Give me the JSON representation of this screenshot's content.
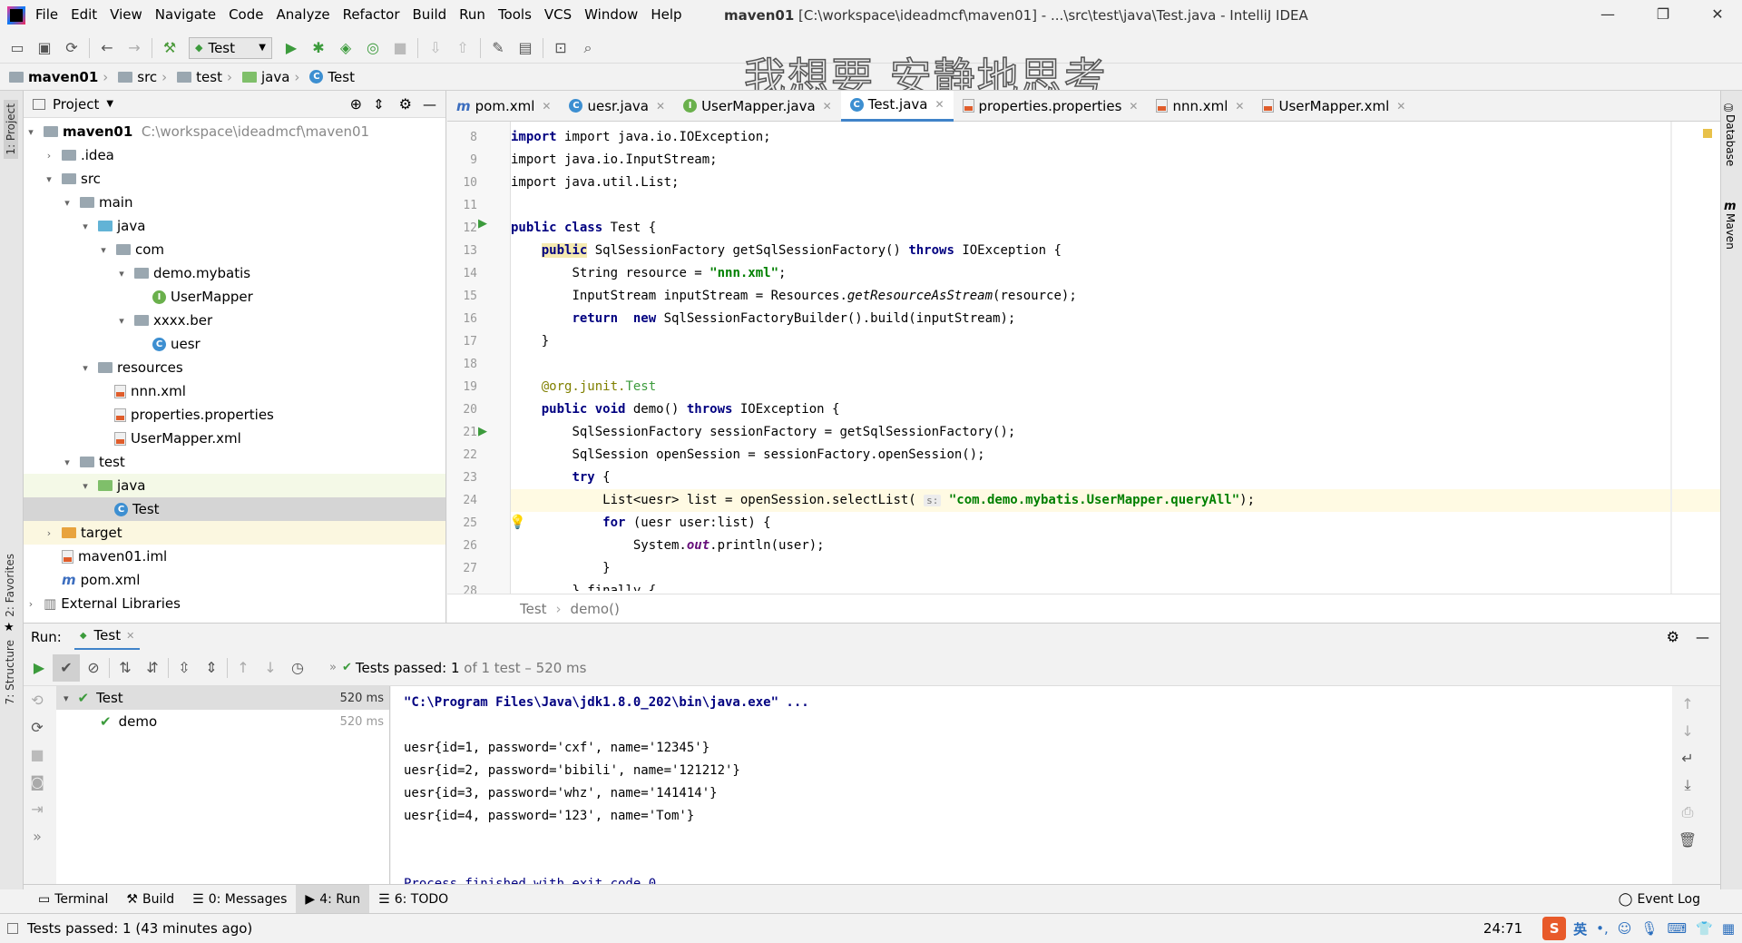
{
  "window": {
    "menu": [
      "File",
      "Edit",
      "View",
      "Navigate",
      "Code",
      "Analyze",
      "Refactor",
      "Build",
      "Run",
      "Tools",
      "VCS",
      "Window",
      "Help"
    ],
    "title_project": "maven01",
    "title_rest": "[C:\\workspace\\ideadmcf\\maven01] - ...\\src\\test\\java\\Test.java - IntelliJ IDEA"
  },
  "toolbar": {
    "run_config": "Test"
  },
  "overlay_text": "我想要 安静地思考",
  "breadcrumbs": [
    "maven01",
    "src",
    "test",
    "java",
    "Test"
  ],
  "left_strip": {
    "project": "1: Project",
    "favorites": "2: Favorites",
    "structure": "7: Structure"
  },
  "right_strip": {
    "database": "Database",
    "maven": "Maven"
  },
  "project_panel": {
    "title": "Project",
    "tree": [
      {
        "label": "maven01",
        "extra": "C:\\workspace\\ideadmcf\\maven01"
      },
      {
        "label": ".idea"
      },
      {
        "label": "src"
      },
      {
        "label": "main"
      },
      {
        "label": "java"
      },
      {
        "label": "com"
      },
      {
        "label": "demo.mybatis"
      },
      {
        "label": "UserMapper"
      },
      {
        "label": "xxxx.ber"
      },
      {
        "label": "uesr"
      },
      {
        "label": "resources"
      },
      {
        "label": "nnn.xml"
      },
      {
        "label": "properties.properties"
      },
      {
        "label": "UserMapper.xml"
      },
      {
        "label": "test"
      },
      {
        "label": "java"
      },
      {
        "label": "Test"
      },
      {
        "label": "target"
      },
      {
        "label": "maven01.iml"
      },
      {
        "label": "pom.xml"
      },
      {
        "label": "External Libraries"
      }
    ]
  },
  "editor_tabs": [
    "pom.xml",
    "uesr.java",
    "UserMapper.java",
    "Test.java",
    "properties.properties",
    "nnn.xml",
    "UserMapper.xml"
  ],
  "line_numbers": [
    "8",
    "9",
    "10",
    "11",
    "12",
    "13",
    "14",
    "15",
    "16",
    "17",
    "18",
    "19",
    "20",
    "21",
    "22",
    "23",
    "24",
    "25",
    "26",
    "27",
    "28"
  ],
  "code": {
    "l8": "import java.io.IOException;",
    "l9": "import java.io.InputStream;",
    "l10": "import java.util.List;",
    "l12_kw": "public class",
    "l12_rest": " Test {",
    "l13_a": "public",
    "l13_b": " SqlSessionFactory getSqlSessionFactory() ",
    "l13_c": "throws",
    "l13_d": " IOException {",
    "l14_a": "String resource = ",
    "l14_b": "\"nnn.xml\"",
    "l14_c": ";",
    "l15_a": "InputStream inputStream = Resources.",
    "l15_b": "getResourceAsStream",
    "l15_c": "(resource);",
    "l16_a": "return  new",
    "l16_b": " SqlSessionFactoryBuilder().build(inputStream);",
    "l17": "}",
    "l19_a": "@org.junit.",
    "l19_b": "Test",
    "l20_a": "public void",
    "l20_b": " demo() ",
    "l20_c": "throws",
    "l20_d": " IOException {",
    "l21": "SqlSessionFactory sessionFactory = getSqlSessionFactory();",
    "l22": "SqlSession openSession = sessionFactory.openSession();",
    "l23_a": "try",
    "l23_b": " {",
    "l24_a": "List<uesr> list = openSession.selectList( ",
    "l24_hint": "s:",
    "l24_b": " \"com.demo.mybatis.UserMapper.queryAll\"",
    "l24_c": ");",
    "l25_a": "for",
    "l25_b": " (uesr user:list) {",
    "l26_a": "System.",
    "l26_b": "out",
    "l26_c": ".println(user);",
    "l27": "}",
    "l28": "} finally {"
  },
  "editor_breadcrumb": [
    "Test",
    "demo()"
  ],
  "run_panel": {
    "label": "Run:",
    "tab": "Test",
    "status_prefix": "Tests passed:",
    "status_count": "1",
    "status_rest": "of 1 test – 520 ms",
    "tests": [
      {
        "name": "Test",
        "time": "520 ms"
      },
      {
        "name": "demo",
        "time": "520 ms"
      }
    ],
    "console": [
      "\"C:\\Program Files\\Java\\jdk1.8.0_202\\bin\\java.exe\" ...",
      "",
      "uesr{id=1, password='cxf', name='12345'}",
      "uesr{id=2, password='bibili', name='121212'}",
      "uesr{id=3, password='whz', name='141414'}",
      "uesr{id=4, password='123', name='Tom'}",
      "",
      "",
      "Process finished with exit code 0"
    ]
  },
  "bottom_tabs": [
    "Terminal",
    "Build",
    "0: Messages",
    "4: Run",
    "6: TODO"
  ],
  "event_log": "Event Log",
  "status": {
    "message": "Tests passed: 1 (43 minutes ago)",
    "position": "24:71",
    "ime": "英"
  },
  "colors": {
    "accent": "#4083c9",
    "passed": "#3c9b3c",
    "run": "#3c9b3c"
  }
}
